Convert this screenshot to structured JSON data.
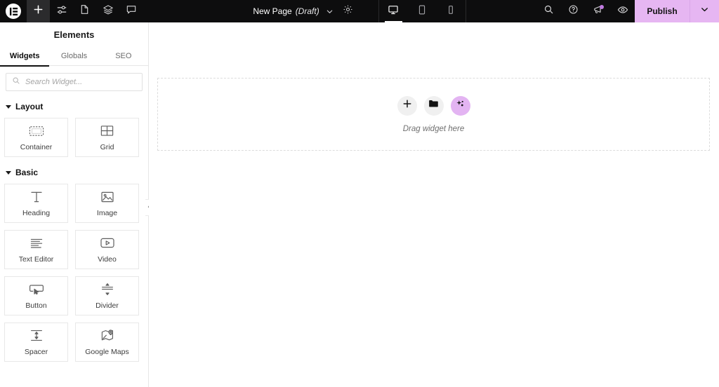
{
  "topbar": {
    "logo": "elementor-logo",
    "left_icons": [
      {
        "name": "add-element-button",
        "icon": "plus-icon",
        "active": true
      },
      {
        "name": "site-settings-button",
        "icon": "sliders-icon",
        "active": false
      },
      {
        "name": "page-settings-button",
        "icon": "document-icon",
        "active": false
      },
      {
        "name": "structure-button",
        "icon": "layers-icon",
        "active": false
      },
      {
        "name": "comments-button",
        "icon": "comment-icon",
        "active": false
      }
    ],
    "page_name": "New Page",
    "page_status": "(Draft)",
    "settings_icon": "gear-icon",
    "responsive_modes": [
      {
        "name": "desktop",
        "icon": "desktop-icon",
        "active": true
      },
      {
        "name": "tablet",
        "icon": "tablet-icon",
        "active": false
      },
      {
        "name": "mobile",
        "icon": "mobile-icon",
        "active": false
      }
    ],
    "right_icons": [
      {
        "name": "search-button",
        "icon": "search-icon"
      },
      {
        "name": "help-button",
        "icon": "help-circle-icon"
      },
      {
        "name": "notifications-button",
        "icon": "megaphone-icon",
        "badge": true
      },
      {
        "name": "preview-button",
        "icon": "eye-icon"
      }
    ],
    "publish_label": "Publish",
    "publish_chevron": "chevron-down-icon",
    "colors": {
      "bar_bg": "#0d0d0e",
      "publish_bg": "#e6b6f2",
      "badge": "#c07ae0"
    }
  },
  "panel": {
    "title": "Elements",
    "tabs": [
      {
        "label": "Widgets",
        "active": true
      },
      {
        "label": "Globals",
        "active": false
      },
      {
        "label": "SEO",
        "active": false
      }
    ],
    "search": {
      "placeholder": "Search Widget...",
      "value": "",
      "icon": "search-icon"
    },
    "sections": [
      {
        "title": "Layout",
        "widgets": [
          {
            "label": "Container",
            "icon": "container-icon"
          },
          {
            "label": "Grid",
            "icon": "grid-icon"
          }
        ]
      },
      {
        "title": "Basic",
        "widgets": [
          {
            "label": "Heading",
            "icon": "heading-icon"
          },
          {
            "label": "Image",
            "icon": "image-icon"
          },
          {
            "label": "Text Editor",
            "icon": "text-editor-icon"
          },
          {
            "label": "Video",
            "icon": "video-icon"
          },
          {
            "label": "Button",
            "icon": "button-icon"
          },
          {
            "label": "Divider",
            "icon": "divider-icon"
          },
          {
            "label": "Spacer",
            "icon": "spacer-icon"
          },
          {
            "label": "Google Maps",
            "icon": "google-maps-icon"
          }
        ]
      }
    ],
    "collapse_icon": "chevron-left-icon"
  },
  "canvas": {
    "dropzone": {
      "label": "Drag widget here",
      "buttons": [
        {
          "name": "add-new-element",
          "icon": "plus-icon",
          "accent": false
        },
        {
          "name": "add-template",
          "icon": "folder-icon",
          "accent": false
        },
        {
          "name": "ai-builder",
          "icon": "sparkle-icon",
          "accent": true
        }
      ],
      "accent_color": "#e3b4f2"
    }
  }
}
